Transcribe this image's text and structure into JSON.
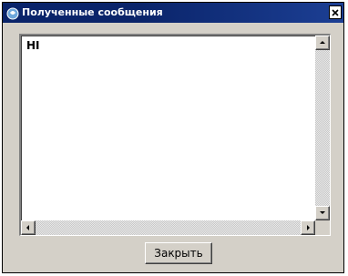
{
  "window": {
    "title": "Полученные сообщения",
    "close_glyph": "×",
    "icon": "app-icon"
  },
  "memo": {
    "text": "HI"
  },
  "buttons": {
    "close_label": "Закрыть"
  },
  "colors": {
    "titlebar": "#0a246a",
    "face": "#d4d0c8",
    "memo_bg": "#ffffff",
    "text": "#000000"
  }
}
